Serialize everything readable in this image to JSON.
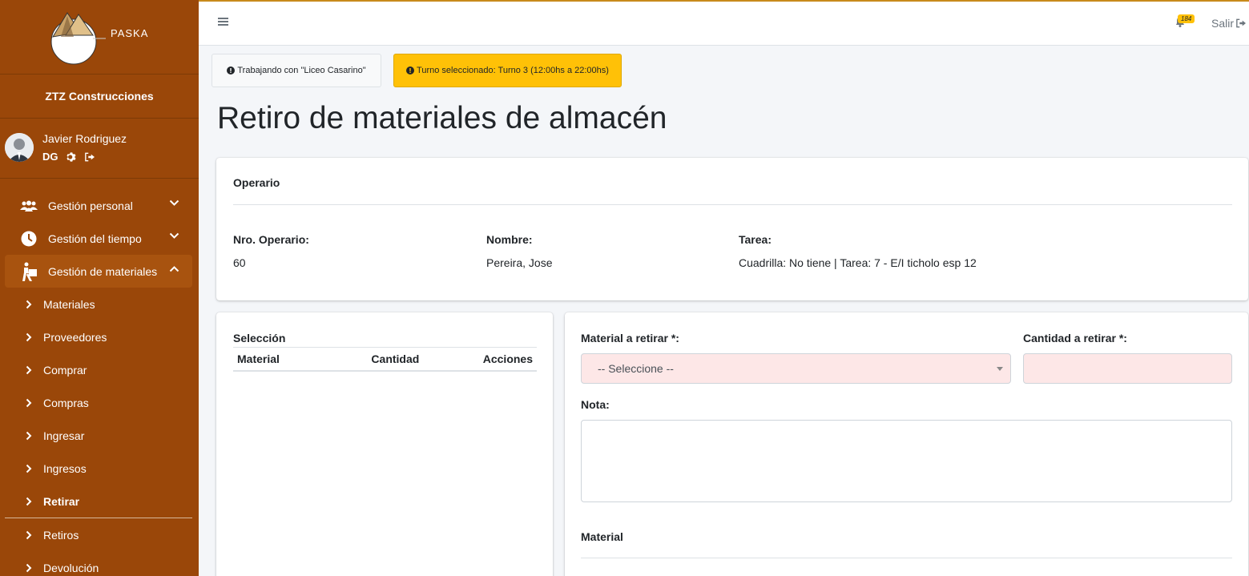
{
  "brand": {
    "name": "PASKA",
    "company": "ZTZ Construcciones"
  },
  "user": {
    "name": "Javier Rodriguez",
    "initials": "DG"
  },
  "nav": {
    "gestion_personal": "Gestión personal",
    "gestion_tiempo": "Gestión del tiempo",
    "gestion_materiales": "Gestión de materiales",
    "sub_items": [
      "Materiales",
      "Proveedores",
      "Comprar",
      "Compras",
      "Ingresar",
      "Ingresos",
      "Retirar"
    ],
    "retiros": "Retiros",
    "devolucion": "Devolución"
  },
  "topbar": {
    "notification_count": "184",
    "logout_label": "Salir"
  },
  "alerts": {
    "working_with": "Trabajando con \"Liceo Casarino\"",
    "shift": "Turno seleccionado: Turno 3 (12:00hs a 22:00hs)"
  },
  "page_title": "Retiro de materiales de almacén",
  "operario": {
    "title": "Operario",
    "nro_label": "Nro. Operario:",
    "nro_value": "60",
    "nombre_label": "Nombre:",
    "nombre_value": "Pereira, Jose",
    "tarea_label": "Tarea:",
    "tarea_value": "Cuadrilla: No tiene | Tarea: 7 - E/I ticholo esp 12"
  },
  "seleccion": {
    "title": "Selección",
    "columns": [
      "Material",
      "Cantidad",
      "Acciones"
    ]
  },
  "form": {
    "material_label": "Material a retirar *:",
    "material_placeholder": "-- Seleccione --",
    "cantidad_label": "Cantidad a retirar *:",
    "nota_label": "Nota:",
    "material_section": "Material"
  },
  "colors": {
    "sidebar": "#9a4709",
    "warning": "#ffc107",
    "invalid_bg": "#fde7e7"
  }
}
